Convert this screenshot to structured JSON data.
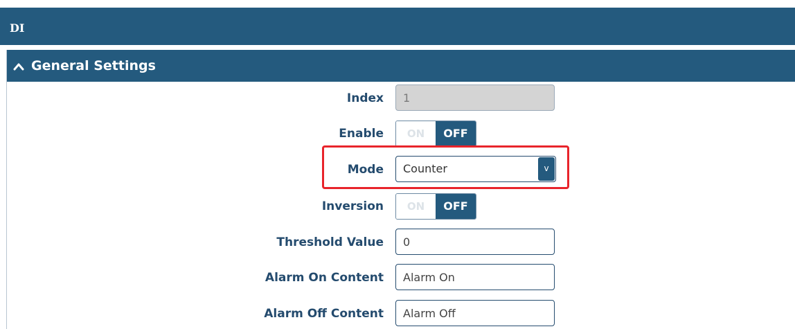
{
  "page": {
    "title": "DI"
  },
  "section": {
    "title": "General Settings",
    "collapse_icon": "chevron-up-icon"
  },
  "form": {
    "index": {
      "label": "Index",
      "value": "1"
    },
    "enable": {
      "label": "Enable",
      "on_label": "ON",
      "off_label": "OFF",
      "state": "off"
    },
    "mode": {
      "label": "Mode",
      "value": "Counter",
      "dropdown_icon": "v"
    },
    "inversion": {
      "label": "Inversion",
      "on_label": "ON",
      "off_label": "OFF",
      "state": "off"
    },
    "threshold": {
      "label": "Threshold Value",
      "value": "0"
    },
    "alarm_on": {
      "label": "Alarm On Content",
      "value": "Alarm On"
    },
    "alarm_off": {
      "label": "Alarm Off Content",
      "value": "Alarm Off"
    }
  },
  "colors": {
    "header_bg": "#245a7e",
    "label_text": "#244b6e",
    "highlight": "#e8242b"
  }
}
